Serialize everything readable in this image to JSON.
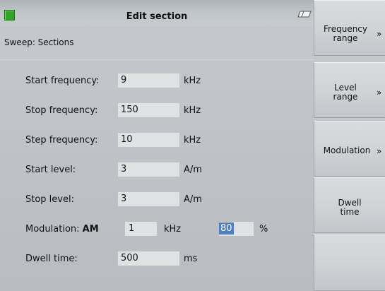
{
  "window": {
    "title": "Edit section",
    "subtitle": "Sweep: Sections",
    "status_color": "#2fa52a"
  },
  "fields": {
    "start_frequency": {
      "label": "Start frequency:",
      "value": "9",
      "unit": "kHz"
    },
    "stop_frequency": {
      "label": "Stop frequency:",
      "value": "150",
      "unit": "kHz"
    },
    "step_frequency": {
      "label": "Step frequency:",
      "value": "10",
      "unit": "kHz"
    },
    "start_level": {
      "label": "Start level:",
      "value": "3",
      "unit": "A/m"
    },
    "stop_level": {
      "label": "Stop level:",
      "value": "3",
      "unit": "A/m"
    },
    "modulation": {
      "label": "Modulation:",
      "type": "AM",
      "rate_value": "1",
      "rate_unit": "kHz",
      "depth_value": "80",
      "depth_unit": "%"
    },
    "dwell_time": {
      "label": "Dwell time:",
      "value": "500",
      "unit": "ms"
    }
  },
  "softkeys": [
    {
      "line1": "Frequency",
      "line2": "range",
      "arrow": "»"
    },
    {
      "line1": "Level",
      "line2": "range",
      "arrow": "»"
    },
    {
      "line1": "Modulation",
      "line2": "",
      "arrow": "»"
    },
    {
      "line1": "Dwell",
      "line2": "time",
      "arrow": ""
    },
    {
      "line1": "",
      "line2": "",
      "arrow": ""
    }
  ],
  "icons": {
    "status": "status-led-icon",
    "eraser": "eraser-icon"
  },
  "accent": {
    "selection": "#4f7fc2"
  }
}
